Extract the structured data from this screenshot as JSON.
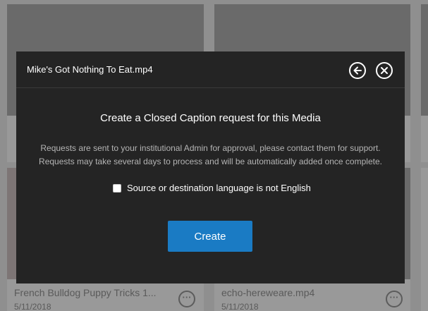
{
  "modal": {
    "title": "Mike's Got Nothing To Eat.mp4",
    "heading": "Create a Closed Caption request for this Media",
    "info_line1": "Requests are sent to your institutional Admin for approval, please contact them for support.",
    "info_line2": "Requests may take several days to process and will be automatically added once complete.",
    "checkbox_label": "Source or destination language is not English",
    "checkbox_checked": false,
    "create_label": "Create",
    "back_icon": "arrow-left-circle-icon",
    "close_icon": "close-circle-icon",
    "accent_color": "#1a7bc4"
  },
  "background_tiles": [
    {
      "caption": "French Bulldog Puppy Tricks 1...",
      "date": "5/11/2018"
    },
    {
      "caption": "echo-hereweare.mp4",
      "date": "5/11/2018"
    }
  ]
}
